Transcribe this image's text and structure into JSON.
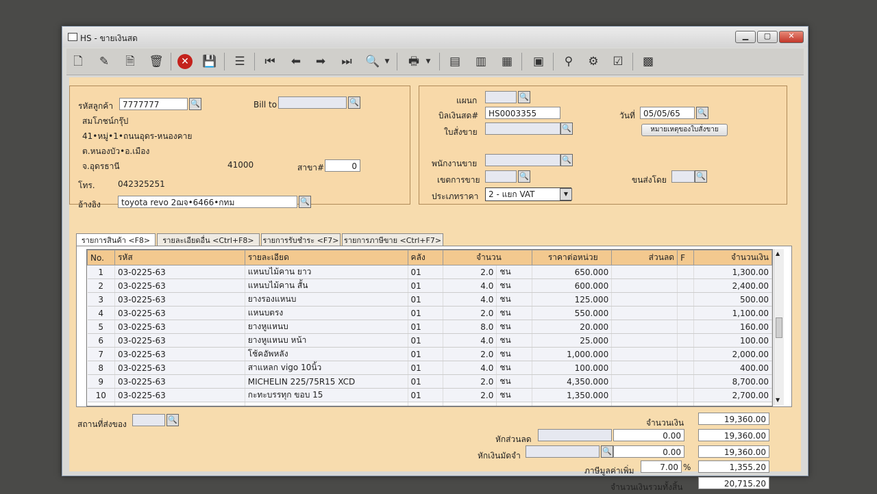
{
  "window": {
    "title": "HS - ขายเงินสด",
    "min": "▁",
    "max": "▢",
    "close": "✕"
  },
  "toolbar": {
    "icons": [
      "new-document-icon",
      "edit-icon",
      "delete-icon",
      "trash-icon",
      "cancel-icon",
      "save-icon",
      "stack-icon",
      "first-record-icon",
      "previous-record-icon",
      "next-record-icon",
      "last-record-icon",
      "search-icon",
      "print-icon",
      "report-1-icon",
      "report-2-icon",
      "chart-icon",
      "calendar-icon",
      "approve-icon",
      "tools-icon",
      "ok-icon",
      "calculator-icon"
    ]
  },
  "customer": {
    "code_label": "รหัสลูกค้า",
    "code_value": "7777777",
    "billto_label": "Bill to",
    "billto_value": "",
    "name": "สมโภชน์กรุ๊ป",
    "addr1": "41•หมู่•1•ถนนอุดร-หนองคาย",
    "addr2": "ต.หนองบัว•อ.เมือง",
    "addr3": "จ.อุดรธานี",
    "zip": "41000",
    "branch_label": "สาขา#",
    "branch_value": "0",
    "phone_label": "โทร.",
    "phone_value": "042325251",
    "ref_label": "อ้างอิง",
    "ref_value": "toyota revo 2ฌจ•6466•กทม"
  },
  "bill": {
    "dept_label": "แผนก",
    "dept_value": "",
    "cashbill_label": "บิลเงินสด#",
    "cashbill_value": "HS0003355",
    "date_label": "วันที่",
    "date_value": "05/05/65",
    "order_label": "ใบสั่งขาย",
    "order_value": "",
    "note_button": "หมายเหตุของใบสั่งขาย",
    "staff_label": "พนักงานขาย",
    "staff_value": "",
    "zone_label": "เขตการขาย",
    "zone_value": "",
    "ship_label": "ขนส่งโดย",
    "ship_value": "",
    "price_type_label": "ประเภทราคา",
    "price_type_value": "2 - แยก VAT"
  },
  "tabs": [
    "รายการสินค้า <F8>",
    "รายละเอียดอื่น <Ctrl+F8>",
    "รายการรับชำระ <F7>",
    "รายการภาษีขาย <Ctrl+F7>"
  ],
  "grid": {
    "headers": [
      "No.",
      "รหัส",
      "รายละเอียด",
      "คลัง",
      "จำนวน",
      "ราคาต่อหน่วย",
      "ส่วนลด",
      "F",
      "จำนวนเงิน"
    ],
    "rows": [
      [
        "1",
        "03-0225-63",
        "แหนบไม้คาน ยาว",
        "01",
        "2.0",
        "ชน",
        "650.000",
        "",
        "1,300.00"
      ],
      [
        "2",
        "03-0225-63",
        "แหนบไม้คาน สั้น",
        "01",
        "4.0",
        "ชน",
        "600.000",
        "",
        "2,400.00"
      ],
      [
        "3",
        "03-0225-63",
        "ยางรองแหนบ",
        "01",
        "4.0",
        "ชน",
        "125.000",
        "",
        "500.00"
      ],
      [
        "4",
        "03-0225-63",
        "แหนบตรง",
        "01",
        "2.0",
        "ชน",
        "550.000",
        "",
        "1,100.00"
      ],
      [
        "5",
        "03-0225-63",
        "ยางหูแหนบ",
        "01",
        "8.0",
        "ชน",
        "20.000",
        "",
        "160.00"
      ],
      [
        "6",
        "03-0225-63",
        "ยางหูแหนบ หน้า",
        "01",
        "4.0",
        "ชน",
        "25.000",
        "",
        "100.00"
      ],
      [
        "7",
        "03-0225-63",
        "โช้คอัพหลัง",
        "01",
        "2.0",
        "ชน",
        "1,000.000",
        "",
        "2,000.00"
      ],
      [
        "8",
        "03-0225-63",
        "สาแหลก vigo 10นิ้ว",
        "01",
        "4.0",
        "ชน",
        "100.000",
        "",
        "400.00"
      ],
      [
        "9",
        "03-0225-63",
        "MICHELIN 225/75R15 XCD",
        "01",
        "2.0",
        "ชน",
        "4,350.000",
        "",
        "8,700.00"
      ],
      [
        "10",
        "03-0225-63",
        "กะทะบรรทุก ขอบ 15",
        "01",
        "2.0",
        "ชน",
        "1,350.000",
        "",
        "2,700.00"
      ]
    ]
  },
  "footer": {
    "delivery_label": "สถานที่ส่งของ",
    "delivery_value": "",
    "amount_label": "จำนวนเงิน",
    "amount_value": "19,360.00",
    "discount_label": "หักส่วนลด",
    "discount_input": "",
    "discount_value": "0.00",
    "after_discount": "19,360.00",
    "deposit_label": "หักเงินมัดจำ",
    "deposit_input": "",
    "deposit_value": "0.00",
    "after_deposit": "19,360.00",
    "vat_label": "ภาษีมูลค่าเพิ่ม",
    "vat_rate": "7.00",
    "vat_pct": "%",
    "vat_value": "1,355.20",
    "total_label": "จำนวนเงินรวมทั้งสิ้น",
    "total_value": "20,715.20"
  }
}
